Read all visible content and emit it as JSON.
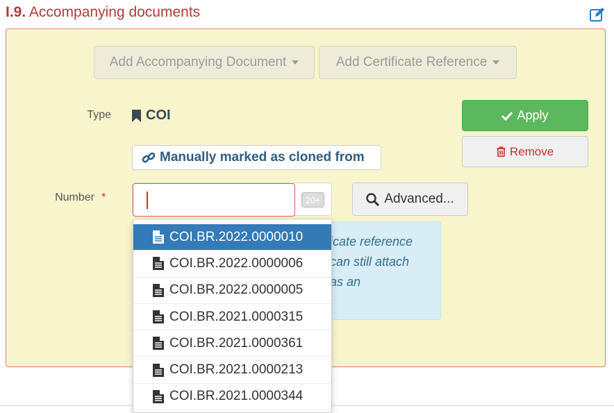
{
  "section": {
    "number": "I.9.",
    "title": "Accompanying documents"
  },
  "buttons": {
    "add_document": "Add Accompanying Document",
    "add_certificate": "Add Certificate Reference",
    "apply": "Apply",
    "remove": "Remove",
    "advanced": "Advanced..."
  },
  "form": {
    "type_label": "Type",
    "type_value": "COI",
    "cloned_badge": "Manually marked as cloned from",
    "number_label": "Number",
    "required_marker": "*",
    "number_value": "",
    "number_counter": "20+"
  },
  "info": {
    "lines": [
      "icate reference",
      "can still attach",
      "as an"
    ]
  },
  "dropdown": {
    "selected_index": 0,
    "items": [
      "COI.BR.2022.0000010",
      "COI.BR.2022.0000006",
      "COI.BR.2022.0000005",
      "COI.BR.2021.0000315",
      "COI.BR.2021.0000361",
      "COI.BR.2021.0000213",
      "COI.BR.2021.0000344"
    ]
  },
  "colors": {
    "title_red": "#b33a3a",
    "panel_bg": "#f8f5cc",
    "apply_green": "#5cb85c",
    "remove_red": "#c9302c",
    "selected_blue": "#337ab7",
    "info_bg": "#d9edf7"
  },
  "icons": {
    "edit": "edit-icon",
    "bookmark": "bookmark-icon",
    "link": "link-icon",
    "check": "check-icon",
    "trash": "trash-icon",
    "search": "search-icon",
    "file": "file-icon"
  }
}
